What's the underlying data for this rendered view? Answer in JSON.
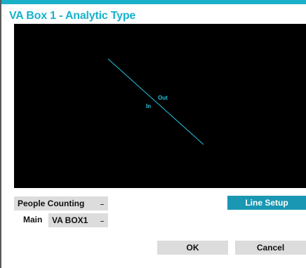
{
  "dialog": {
    "title": "VA Box 1 - Analytic Type",
    "accent_color": "#17b2cc"
  },
  "video": {
    "line_color": "#27c4e0",
    "in_label": "In",
    "out_label": "Out"
  },
  "controls": {
    "analytic_type": "People Counting",
    "main_label": "Main",
    "va_box_select": "VA BOX1",
    "line_setup_label": "Line Setup"
  },
  "footer": {
    "ok_label": "OK",
    "cancel_label": "Cancel"
  }
}
